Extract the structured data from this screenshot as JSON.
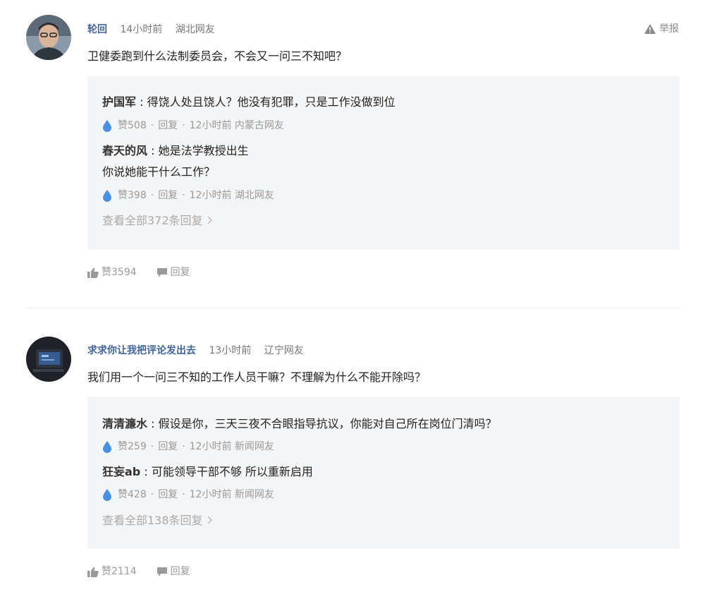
{
  "report_label": "举报",
  "comments": [
    {
      "username": "轮回",
      "time": "14小时前",
      "location": "湖北网友",
      "content": "卫健委跑到什么法制委员会，不会又一问三不知吧？",
      "replies": [
        {
          "user": "护国军",
          "lines": [
            "得饶人处且饶人？他没有犯罪，只是工作没做到位"
          ],
          "likes": "赞508",
          "reply_label": "回复",
          "time": "12小时前",
          "location": "内蒙古网友"
        },
        {
          "user": "春天的风",
          "lines": [
            "她是法学教授出生",
            "你说她能干什么工作？"
          ],
          "likes": "赞398",
          "reply_label": "回复",
          "time": "12小时前",
          "location": "湖北网友"
        }
      ],
      "view_all": "查看全部372条回复",
      "likes": "赞3594",
      "reply_label": "回复"
    },
    {
      "username": "求求你让我把评论发出去",
      "time": "13小时前",
      "location": "辽宁网友",
      "content": "我们用一个一问三不知的工作人员干嘛？不理解为什么不能开除吗？",
      "replies": [
        {
          "user": "清清濂水",
          "lines": [
            "假设是你，三天三夜不合眼指导抗议，你能对自己所在岗位门清吗？"
          ],
          "likes": "赞259",
          "reply_label": "回复",
          "time": "12小时前",
          "location": "新闻网友"
        },
        {
          "user": "狂妄ab",
          "lines": [
            "可能领导干部不够 所以重新启用"
          ],
          "likes": "赞428",
          "reply_label": "回复",
          "time": "12小时前",
          "location": "新闻网友"
        }
      ],
      "view_all": "查看全部138条回复",
      "likes": "赞2114",
      "reply_label": "回复"
    }
  ],
  "colors": {
    "username": "#406599",
    "reply_box_bg": "#f4f5f6",
    "meta_gray": "#999999",
    "drop_blue": "#4a90e2"
  },
  "icons": [
    "user-avatar-icon",
    "warning-icon",
    "water-drop-icon",
    "thumbs-up-icon",
    "speech-bubble-icon",
    "chevron-right-icon"
  ]
}
